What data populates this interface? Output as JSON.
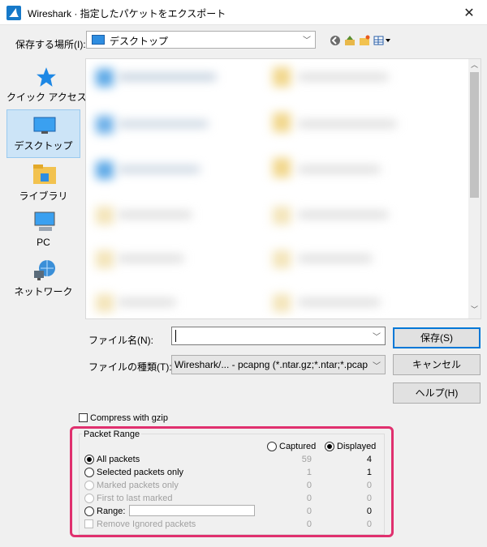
{
  "window": {
    "title": "Wireshark · 指定したパケットをエクスポート",
    "close_glyph": "✕"
  },
  "save_in": {
    "label": "保存する場所(I):",
    "value": "デスクトップ"
  },
  "toolbar": {
    "back_icon": "back-icon",
    "up_icon": "up-folder-icon",
    "new_folder_icon": "new-folder-icon",
    "view_icon": "view-menu-icon"
  },
  "places": [
    {
      "label": "クイック アクセス",
      "icon": "star-icon"
    },
    {
      "label": "デスクトップ",
      "icon": "desktop-icon",
      "selected": true
    },
    {
      "label": "ライブラリ",
      "icon": "library-icon"
    },
    {
      "label": "PC",
      "icon": "pc-icon"
    },
    {
      "label": "ネットワーク",
      "icon": "network-icon"
    }
  ],
  "file_name": {
    "label": "ファイル名(N):",
    "value": ""
  },
  "file_type": {
    "label": "ファイルの種類(T):",
    "value": "Wireshark/... - pcapng (*.ntar.gz;*.ntar;*.pcapng.gz;*.pcapng)"
  },
  "buttons": {
    "save": "保存(S)",
    "cancel": "キャンセル",
    "help": "ヘルプ(H)"
  },
  "compress": {
    "label": "Compress with gzip",
    "checked": false
  },
  "packet_range": {
    "title": "Packet Range",
    "captured_label": "Captured",
    "displayed_label": "Displayed",
    "mode": "Displayed",
    "rows": [
      {
        "label": "All packets",
        "captured": "59",
        "displayed": "4",
        "selected": true,
        "enabled": true
      },
      {
        "label": "Selected packets only",
        "captured": "1",
        "displayed": "1",
        "selected": false,
        "enabled": true
      },
      {
        "label": "Marked packets only",
        "captured": "0",
        "displayed": "0",
        "selected": false,
        "enabled": false
      },
      {
        "label": "First to last marked",
        "captured": "0",
        "displayed": "0",
        "selected": false,
        "enabled": false
      },
      {
        "label": "Range:",
        "captured": "0",
        "displayed": "0",
        "selected": false,
        "enabled": true
      },
      {
        "label": "Remove Ignored packets",
        "captured": "0",
        "displayed": "0",
        "selected": false,
        "enabled": false
      }
    ]
  },
  "colors": {
    "highlight": "#e0306e",
    "accent": "#0078d7"
  }
}
